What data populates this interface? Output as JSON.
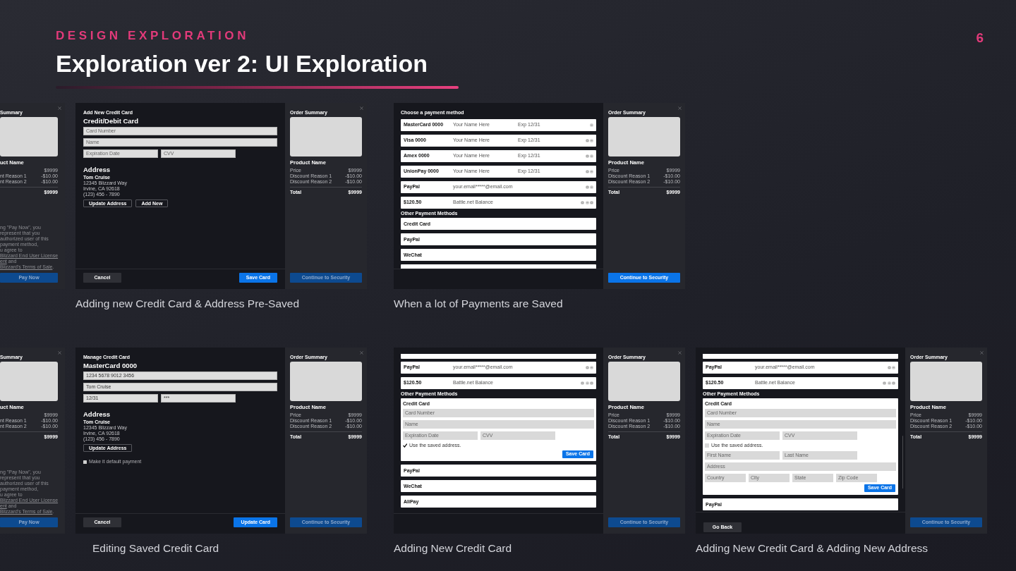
{
  "header": {
    "eyebrow": "DESIGN EXPLORATION",
    "title": "Exploration ver 2: UI Exploration",
    "page": "6"
  },
  "rows": [
    {
      "mockups": [
        {
          "caption": "Adding new Credit Card & Address Pre-Saved",
          "back": {
            "heading": "Summary",
            "product": "uct Name",
            "lines": [
              {
                "value": "$9999"
              },
              {
                "label": "nt Reason 1",
                "value": "-$10.00"
              },
              {
                "label": "nt Reason 2",
                "value": "-$10.00"
              }
            ],
            "total": {
              "value": "$9999"
            },
            "legal": [
              [
                {
                  "text": "ng \"Pay Now\", you represent that you",
                  "link": false
                }
              ],
              [
                {
                  "text": "authorized user of this payment method,",
                  "link": false
                }
              ],
              [
                {
                  "text": "u agree to ",
                  "link": false
                },
                {
                  "text": "Blizzard End User License",
                  "link": true
                }
              ],
              [
                {
                  "text": "ent",
                  "link": true
                },
                {
                  "text": " and ",
                  "link": false
                },
                {
                  "text": "Blizzard's Terms of Sale",
                  "link": true
                },
                {
                  "text": ".",
                  "link": false
                }
              ]
            ],
            "button": {
              "label": "Pay Now",
              "active": false
            }
          },
          "main": {
            "kind": "card_form",
            "breadcrumb": "Add New Credit Card",
            "title": "Credit/Debit Card",
            "fields": [
              [
                {
                  "placeholder": "Card Number"
                }
              ],
              [
                {
                  "placeholder": "Name"
                }
              ],
              [
                {
                  "placeholder": "Expiration Date"
                },
                {
                  "placeholder": "CVV"
                }
              ]
            ],
            "address": {
              "heading": "Address",
              "lines": [
                "Tom Cruise",
                "12345 Blizzard Way",
                "Irvine, CA 92618",
                "(123) 456 - 7890"
              ]
            },
            "address_buttons": [
              "Update Address",
              "Add New"
            ],
            "footer": {
              "cancel": "Cancel",
              "primary": "Save Card"
            }
          },
          "summary": {
            "heading": "Order Summary",
            "product": "Product Name",
            "lines": [
              {
                "label": "Price",
                "value": "$9999"
              },
              {
                "label": "Discount Reason 1",
                "value": "-$10.00"
              },
              {
                "label": "Discount Reason 2",
                "value": "-$10.00"
              }
            ],
            "total": {
              "label": "Total",
              "value": "$9999"
            },
            "button": {
              "label": "Continue to Security",
              "active": false
            }
          }
        },
        {
          "caption": "When a lot of Payments are Saved",
          "main": {
            "kind": "payment_list",
            "title": "Choose a payment method",
            "partial_top": false,
            "scrollbar": false,
            "saved": [
              {
                "name": "MasterCard 0000",
                "holder": "Your Name Here",
                "expiry": "Exp 12/31",
                "actions": [
                  {
                    "kind": "minus"
                  }
                ]
              },
              {
                "name": "Visa 0000",
                "holder": "Your Name Here",
                "expiry": "Exp 12/31",
                "actions": [
                  {
                    "kind": "card"
                  },
                  {
                    "kind": "minus"
                  }
                ]
              },
              {
                "name": "Amex 0000",
                "holder": "Your Name Here",
                "expiry": "Exp 12/31",
                "actions": [
                  {
                    "kind": "card"
                  },
                  {
                    "kind": "minus"
                  }
                ]
              },
              {
                "name": "UnionPay 0000",
                "holder": "Your Name Here",
                "expiry": "Exp 12/31",
                "actions": [
                  {
                    "kind": "card"
                  },
                  {
                    "kind": "minus"
                  }
                ]
              },
              {
                "name": "PayPal",
                "holder": "your.email*****@email.com",
                "actions": [
                  {
                    "kind": "card"
                  },
                  {
                    "kind": "minus"
                  }
                ]
              },
              {
                "name": "$120.50",
                "holder": "Battle.net Balance",
                "actions": [
                  {
                    "kind": "card"
                  },
                  {
                    "kind": "minus"
                  },
                  {
                    "kind": "card"
                  }
                ]
              }
            ],
            "other_heading": "Other Payment Methods",
            "other": [
              {
                "name": "Credit Card",
                "expanded": false
              },
              {
                "name": "PayPal",
                "expanded": false
              },
              {
                "name": "WeChat",
                "expanded": false
              }
            ],
            "partial_bottom": true
          },
          "summary": {
            "heading": "Order Summary",
            "product": "Product Name",
            "lines": [
              {
                "label": "Price",
                "value": "$9999"
              },
              {
                "label": "Discount Reason 1",
                "value": "-$10.00"
              },
              {
                "label": "Discount Reason 2",
                "value": "-$10.00"
              }
            ],
            "total": {
              "label": "Total",
              "value": "$9999"
            },
            "button": {
              "label": "Continue to Security",
              "active": true
            }
          }
        }
      ]
    },
    {
      "mockups": [
        {
          "caption": "Editing Saved Credit Card",
          "back": {
            "heading": "Summary",
            "product": "uct Name",
            "lines": [
              {
                "value": "$9999"
              },
              {
                "label": "nt Reason 1",
                "value": "-$10.00"
              },
              {
                "label": "nt Reason 2",
                "value": "-$10.00"
              }
            ],
            "total": {
              "value": "$9999"
            },
            "legal": [
              [
                {
                  "text": "ng \"Pay Now\", you represent that you",
                  "link": false
                }
              ],
              [
                {
                  "text": "authorized user of this payment method,",
                  "link": false
                }
              ],
              [
                {
                  "text": "u agree to ",
                  "link": false
                },
                {
                  "text": "Blizzard End User License",
                  "link": true
                }
              ],
              [
                {
                  "text": "ent",
                  "link": true
                },
                {
                  "text": " and ",
                  "link": false
                },
                {
                  "text": "Blizzard's Terms of Sale",
                  "link": true
                },
                {
                  "text": ".",
                  "link": false
                }
              ]
            ],
            "button": {
              "label": "Pay Now",
              "active": false
            }
          },
          "main": {
            "kind": "card_form",
            "breadcrumb": "Manage Credit Card",
            "title": "MasterCard 0000",
            "fields": [
              [
                {
                  "value": "1234 5678 9012 3456"
                }
              ],
              [
                {
                  "value": "Tom Cruise"
                }
              ],
              [
                {
                  "value": "12/31"
                },
                {
                  "value": "***"
                }
              ]
            ],
            "address": {
              "heading": "Address",
              "lines": [
                "Tom Cruise",
                "12345 Blizzard Way",
                "Irvine, CA 92618",
                "(123) 456 - 7890"
              ]
            },
            "address_buttons": [
              "Update Address"
            ],
            "checkbox": {
              "label": "Make it default payment",
              "checked": false
            },
            "footer": {
              "cancel": "Cancel",
              "primary": "Update Card"
            }
          },
          "summary": {
            "heading": "Order Summary",
            "product": "Product Name",
            "lines": [
              {
                "label": "Price",
                "value": "$9999"
              },
              {
                "label": "Discount Reason 1",
                "value": "-$10.00"
              },
              {
                "label": "Discount Reason 2",
                "value": "-$10.00"
              }
            ],
            "total": {
              "label": "Total",
              "value": "$9999"
            },
            "button": {
              "label": "Continue to Security",
              "active": false
            }
          }
        },
        {
          "caption": "Adding New Credit Card",
          "main": {
            "kind": "payment_list",
            "partial_top": true,
            "saved": [
              {
                "name": "PayPal",
                "holder": "your.email*****@email.com",
                "actions": [
                  {
                    "kind": "card"
                  },
                  {
                    "kind": "minus"
                  }
                ]
              },
              {
                "name": "$120.50",
                "holder": "Battle.net Balance",
                "actions": [
                  {
                    "kind": "card"
                  },
                  {
                    "kind": "minus"
                  },
                  {
                    "kind": "card"
                  }
                ]
              }
            ],
            "other_heading": "Other Payment Methods",
            "other": [
              {
                "name": "Credit Card",
                "expanded": true,
                "fields": [
                  [
                    {
                      "placeholder": "Card Number"
                    }
                  ],
                  [
                    {
                      "placeholder": "Name"
                    }
                  ],
                  [
                    {
                      "placeholder": "Expiration Date"
                    },
                    {
                      "placeholder": "CVV"
                    }
                  ]
                ],
                "checkbox": {
                  "label": "Use the saved address.",
                  "checked": true
                },
                "button": "Save Card"
              },
              {
                "name": "PayPal",
                "expanded": false
              },
              {
                "name": "WeChat",
                "expanded": false
              },
              {
                "name": "AliPay",
                "expanded": false
              }
            ],
            "partial_bottom": false,
            "scrollbar": false
          },
          "summary": {
            "heading": "Order Summary",
            "product": "Product Name",
            "lines": [
              {
                "label": "Price",
                "value": "$9999"
              },
              {
                "label": "Discount Reason 1",
                "value": "-$10.00"
              },
              {
                "label": "Discount Reason 2",
                "value": "-$10.00"
              }
            ],
            "total": {
              "label": "Total",
              "value": "$9999"
            },
            "button": {
              "label": "Continue to Security",
              "active": false
            }
          }
        },
        {
          "caption": "Adding New Credit Card & Adding New Address",
          "main": {
            "kind": "payment_list",
            "partial_top": true,
            "saved": [
              {
                "name": "PayPal",
                "holder": "your.email*****@email.com",
                "actions": [
                  {
                    "kind": "card"
                  },
                  {
                    "kind": "minus"
                  }
                ]
              },
              {
                "name": "$120.50",
                "holder": "Battle.net Balance",
                "actions": [
                  {
                    "kind": "card"
                  },
                  {
                    "kind": "minus"
                  },
                  {
                    "kind": "card"
                  }
                ]
              }
            ],
            "other_heading": "Other Payment Methods",
            "other": [
              {
                "name": "Credit Card",
                "expanded": true,
                "fields": [
                  [
                    {
                      "placeholder": "Card Number"
                    }
                  ],
                  [
                    {
                      "placeholder": "Name"
                    }
                  ],
                  [
                    {
                      "placeholder": "Expiration Date"
                    },
                    {
                      "placeholder": "CVV"
                    }
                  ]
                ],
                "checkbox": {
                  "label": "Use the saved address.",
                  "checked": false
                },
                "address_fields": [
                  [
                    {
                      "placeholder": "First Name"
                    },
                    {
                      "placeholder": "Last Name"
                    }
                  ],
                  [
                    {
                      "placeholder": "Address"
                    }
                  ],
                  [
                    {
                      "placeholder": "Country"
                    },
                    {
                      "placeholder": "City"
                    },
                    {
                      "placeholder": "State"
                    },
                    {
                      "placeholder": "Zip Code"
                    }
                  ]
                ],
                "button": "Save Card"
              },
              {
                "name": "PayPal",
                "expanded": false
              }
            ],
            "partial_bottom": false,
            "scrollbar": true,
            "footer": {
              "back": "Go Back"
            }
          },
          "summary": {
            "heading": "Order Summary",
            "product": "Product Name",
            "lines": [
              {
                "label": "Price",
                "value": "$9999"
              },
              {
                "label": "Discount Reason 1",
                "value": "-$10.00"
              },
              {
                "label": "Discount Reason 2",
                "value": "-$10.00"
              }
            ],
            "total": {
              "label": "Total",
              "value": "$9999"
            },
            "button": {
              "label": "Continue to Security",
              "active": false
            }
          }
        }
      ]
    }
  ]
}
